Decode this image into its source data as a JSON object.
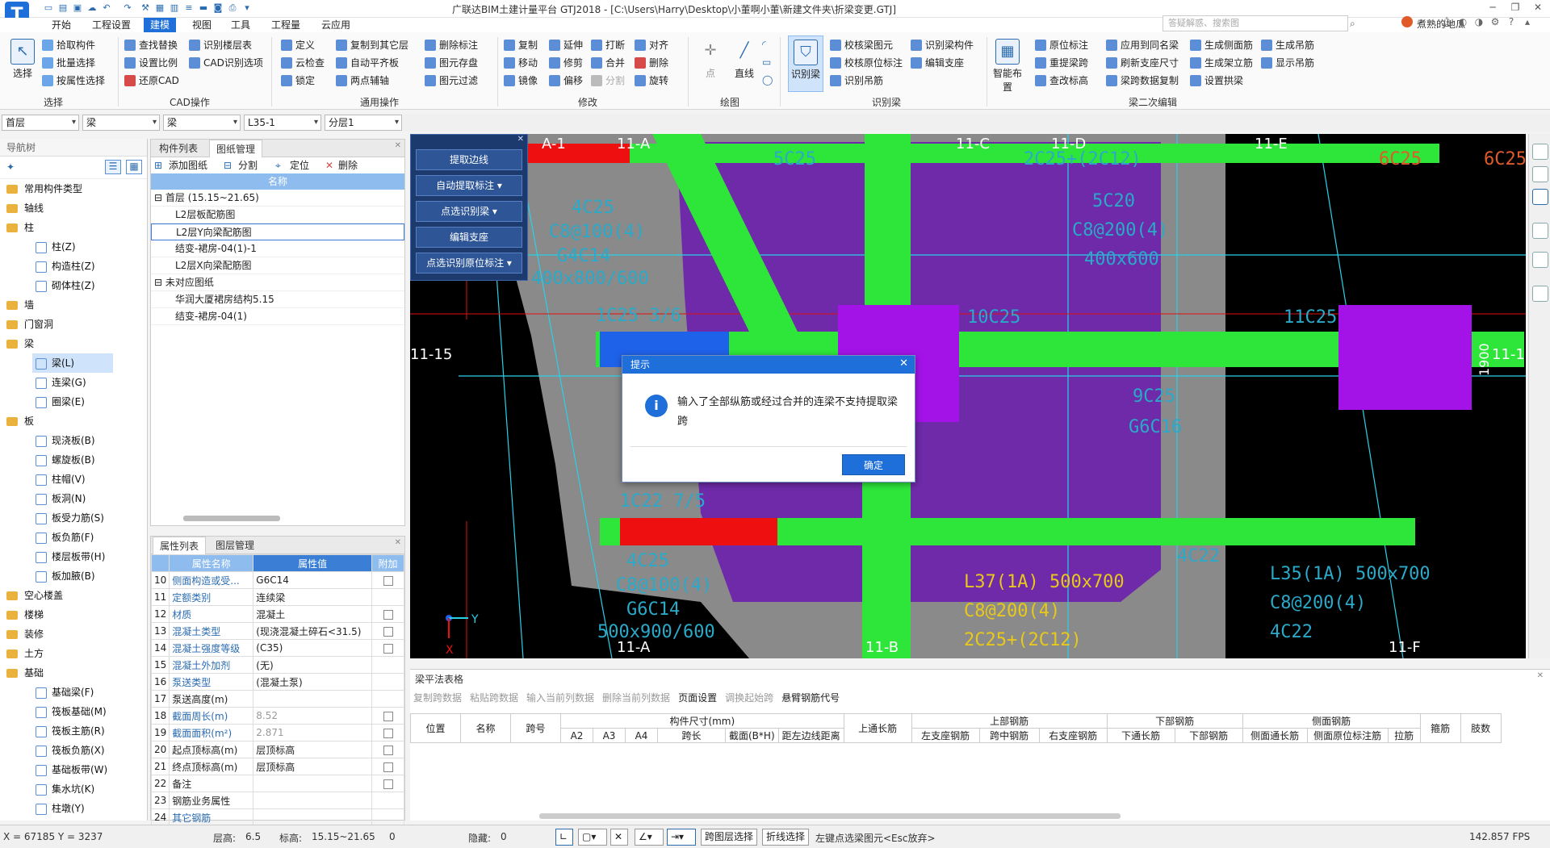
{
  "app": {
    "title": "广联达BIM土建计量平台 GTJ2018 - [C:\\Users\\Harry\\Desktop\\小董啊小董\\新建文件夹\\折梁变更.GTJ]",
    "logo_letter": "T",
    "search_placeholder": "答疑解惑、搜索图",
    "user_name": "煮熟的地瓜"
  },
  "menu": {
    "tabs": [
      "开始",
      "工程设置",
      "建模",
      "视图",
      "工具",
      "工程量",
      "云应用"
    ],
    "active": "建模"
  },
  "ribbon": {
    "select_label": "选择",
    "select_group": {
      "items": [
        "拾取构件",
        "批量选择",
        "按属性选择"
      ],
      "name": "选择"
    },
    "cad_group": {
      "items": [
        "查找替换",
        "识别楼层表",
        "设置比例",
        "CAD识别选项",
        "还原CAD"
      ],
      "name": "CAD操作"
    },
    "general_group": {
      "items": [
        "定义",
        "复制到其它层",
        "删除标注",
        "云检查",
        "自动平齐板",
        "图元存盘",
        "锁定",
        "两点辅轴",
        "图元过滤"
      ],
      "name": "通用操作"
    },
    "modify_group": {
      "items": [
        "复制",
        "延伸",
        "打断",
        "对齐",
        "移动",
        "修剪",
        "合并",
        "删除",
        "镜像",
        "偏移",
        "分割",
        "旋转"
      ],
      "name": "修改"
    },
    "draw_group": {
      "items": [
        "点",
        "直线"
      ],
      "name": "绘图"
    },
    "recognize_group": {
      "items": [
        "识别梁",
        "校核梁图元",
        "识别梁构件",
        "校核原位标注",
        "编辑支座",
        "识别吊筋"
      ],
      "name": "识别梁"
    },
    "beam2_group": {
      "items": [
        "智能布置",
        "原位标注",
        "应用到同名梁",
        "生成侧面筋",
        "生成吊筋",
        "重提梁跨",
        "刷新支座尺寸",
        "生成架立筋",
        "显示吊筋",
        "查改标高",
        "梁跨数据复制",
        "设置拱梁"
      ],
      "name": "梁二次编辑"
    }
  },
  "dropdowns": [
    "首层",
    "梁",
    "梁",
    "L35-1",
    "分层1"
  ],
  "nav": {
    "title": "导航树",
    "items": [
      {
        "label": "常用构件类型",
        "level": 0
      },
      {
        "label": "轴线",
        "level": 0
      },
      {
        "label": "柱",
        "level": 0
      },
      {
        "label": "柱(Z)",
        "level": 1
      },
      {
        "label": "构造柱(Z)",
        "level": 1
      },
      {
        "label": "砌体柱(Z)",
        "level": 1
      },
      {
        "label": "墙",
        "level": 0
      },
      {
        "label": "门窗洞",
        "level": 0
      },
      {
        "label": "梁",
        "level": 0
      },
      {
        "label": "梁(L)",
        "level": 1,
        "selected": true
      },
      {
        "label": "连梁(G)",
        "level": 1
      },
      {
        "label": "圈梁(E)",
        "level": 1
      },
      {
        "label": "板",
        "level": 0
      },
      {
        "label": "现浇板(B)",
        "level": 1
      },
      {
        "label": "螺旋板(B)",
        "level": 1
      },
      {
        "label": "柱帽(V)",
        "level": 1
      },
      {
        "label": "板洞(N)",
        "level": 1
      },
      {
        "label": "板受力筋(S)",
        "level": 1
      },
      {
        "label": "板负筋(F)",
        "level": 1
      },
      {
        "label": "楼层板带(H)",
        "level": 1
      },
      {
        "label": "板加腋(B)",
        "level": 1
      },
      {
        "label": "空心楼盖",
        "level": 0
      },
      {
        "label": "楼梯",
        "level": 0
      },
      {
        "label": "装修",
        "level": 0
      },
      {
        "label": "土方",
        "level": 0
      },
      {
        "label": "基础",
        "level": 0
      },
      {
        "label": "基础梁(F)",
        "level": 1
      },
      {
        "label": "筏板基础(M)",
        "level": 1
      },
      {
        "label": "筏板主筋(R)",
        "level": 1
      },
      {
        "label": "筏板负筋(X)",
        "level": 1
      },
      {
        "label": "基础板带(W)",
        "level": 1
      },
      {
        "label": "集水坑(K)",
        "level": 1
      },
      {
        "label": "柱墩(Y)",
        "level": 1
      }
    ]
  },
  "comp_panel": {
    "tabs": [
      "构件列表",
      "图纸管理"
    ],
    "active_tab": "图纸管理",
    "tools": [
      "添加图纸",
      "分割",
      "定位",
      "删除"
    ],
    "col_header": "名称",
    "rows": [
      {
        "label": "首层 (15.15~21.65)",
        "group": true
      },
      {
        "label": "L2层板配筋图"
      },
      {
        "label": "L2层Y向梁配筋图",
        "selected": true
      },
      {
        "label": "结变-裙房-04(1)-1"
      },
      {
        "label": "L2层X向梁配筋图"
      },
      {
        "label": "未对应图纸",
        "group": true
      },
      {
        "label": "华润大厦裙房结构5.15"
      },
      {
        "label": "结变-裙房-04(1)"
      }
    ]
  },
  "prop_panel": {
    "tabs": [
      "属性列表",
      "图层管理"
    ],
    "headers": [
      "属性名称",
      "属性值",
      "附加"
    ],
    "rows": [
      {
        "n": "10",
        "name": "侧面构造或受...",
        "value": "G6C14",
        "cb": true,
        "blue": true
      },
      {
        "n": "11",
        "name": "定额类别",
        "value": "连续梁",
        "cb": false,
        "blue": true
      },
      {
        "n": "12",
        "name": "材质",
        "value": "混凝土",
        "cb": true,
        "blue": true
      },
      {
        "n": "13",
        "name": "混凝土类型",
        "value": "(现浇混凝土碎石<31.5)",
        "cb": true,
        "blue": true
      },
      {
        "n": "14",
        "name": "混凝土强度等级",
        "value": "(C35)",
        "cb": true,
        "blue": true
      },
      {
        "n": "15",
        "name": "混凝土外加剂",
        "value": "(无)",
        "cb": false,
        "blue": true
      },
      {
        "n": "16",
        "name": "泵送类型",
        "value": "(混凝土泵)",
        "cb": false,
        "blue": true
      },
      {
        "n": "17",
        "name": "泵送高度(m)",
        "value": "",
        "cb": false,
        "blue": false
      },
      {
        "n": "18",
        "name": "截面周长(m)",
        "value": "8.52",
        "cb": true,
        "blue": true
      },
      {
        "n": "19",
        "name": "截面面积(m²)",
        "value": "2.871",
        "cb": true,
        "blue": true
      },
      {
        "n": "20",
        "name": "起点顶标高(m)",
        "value": "层顶标高",
        "cb": true,
        "blue": false
      },
      {
        "n": "21",
        "name": "终点顶标高(m)",
        "value": "层顶标高",
        "cb": true,
        "blue": false
      },
      {
        "n": "22",
        "name": "备注",
        "value": "",
        "cb": true,
        "blue": false
      },
      {
        "n": "23",
        "name": "钢筋业务属性",
        "value": "",
        "cb": false,
        "blue": false
      },
      {
        "n": "24",
        "name": "其它钢筋",
        "value": "",
        "cb": false,
        "blue": true
      }
    ]
  },
  "float_panel": {
    "buttons": [
      "提取边线",
      "自动提取标注",
      "点选识别梁",
      "编辑支座",
      "点选识别原位标注"
    ]
  },
  "canvas": {
    "axis_labels": [
      "A-1",
      "11-A",
      "11-C",
      "11-D",
      "11-E",
      "11-15",
      "11-15",
      "11-A",
      "11-B",
      "11-F"
    ],
    "annotations": [
      "5C25",
      "6C25",
      "2C25+(2C12)",
      "5C20",
      "C8@200(4)",
      "400x600",
      "4C25",
      "C8@100(4)",
      "G4C14",
      "400x800/600",
      "10C25",
      "11C25",
      "1900",
      "9C25",
      "G6C16",
      "1C25 3/6",
      "1C22 7/5",
      "4C25",
      "C8@100(4)",
      "G6C14",
      "500x900/600",
      "L37(1A) 500x700",
      "C8@200(4)",
      "2C25+(2C12)",
      "4C22",
      "L35(1A) 500x700",
      "C8@200(4)",
      "4C22"
    ],
    "axis_y": "Y",
    "axis_x": "X"
  },
  "dialog": {
    "title": "提示",
    "icon": "i",
    "message": "输入了全部纵筋或经过合并的连梁不支持提取梁跨",
    "ok_label": "确定"
  },
  "beam_table": {
    "title": "梁平法表格",
    "tools": [
      "复制跨数据",
      "粘贴跨数据",
      "输入当前列数据",
      "删除当前列数据",
      "页面设置",
      "调换起始跨",
      "悬臂钢筋代号"
    ],
    "enabled_tools": [
      "页面设置",
      "悬臂钢筋代号"
    ],
    "group_headers": [
      "构件尺寸(mm)",
      "上部钢筋",
      "下部钢筋",
      "侧面钢筋"
    ],
    "headers": [
      "位置",
      "名称",
      "跨号",
      "A2",
      "A3",
      "A4",
      "跨长",
      "截面(B*H)",
      "距左边线距离",
      "上通长筋",
      "左支座钢筋",
      "跨中钢筋",
      "右支座钢筋",
      "下通长筋",
      "下部钢筋",
      "侧面通长筋",
      "侧面原位标注筋",
      "拉筋",
      "箍筋",
      "肢数"
    ]
  },
  "status": {
    "coords": "X = 67185 Y = 3237",
    "floor_height_label": "层高:",
    "floor_height": "6.5",
    "elev_label": "标高:",
    "elev": "15.15~21.65",
    "zero": "0",
    "hidden_label": "隐藏:",
    "hidden": "0",
    "btn_layer": "跨图层选择",
    "btn_polyline": "折线选择",
    "hint": "左键点选梁图元<Esc放弃>",
    "fps": "142.857 FPS"
  }
}
